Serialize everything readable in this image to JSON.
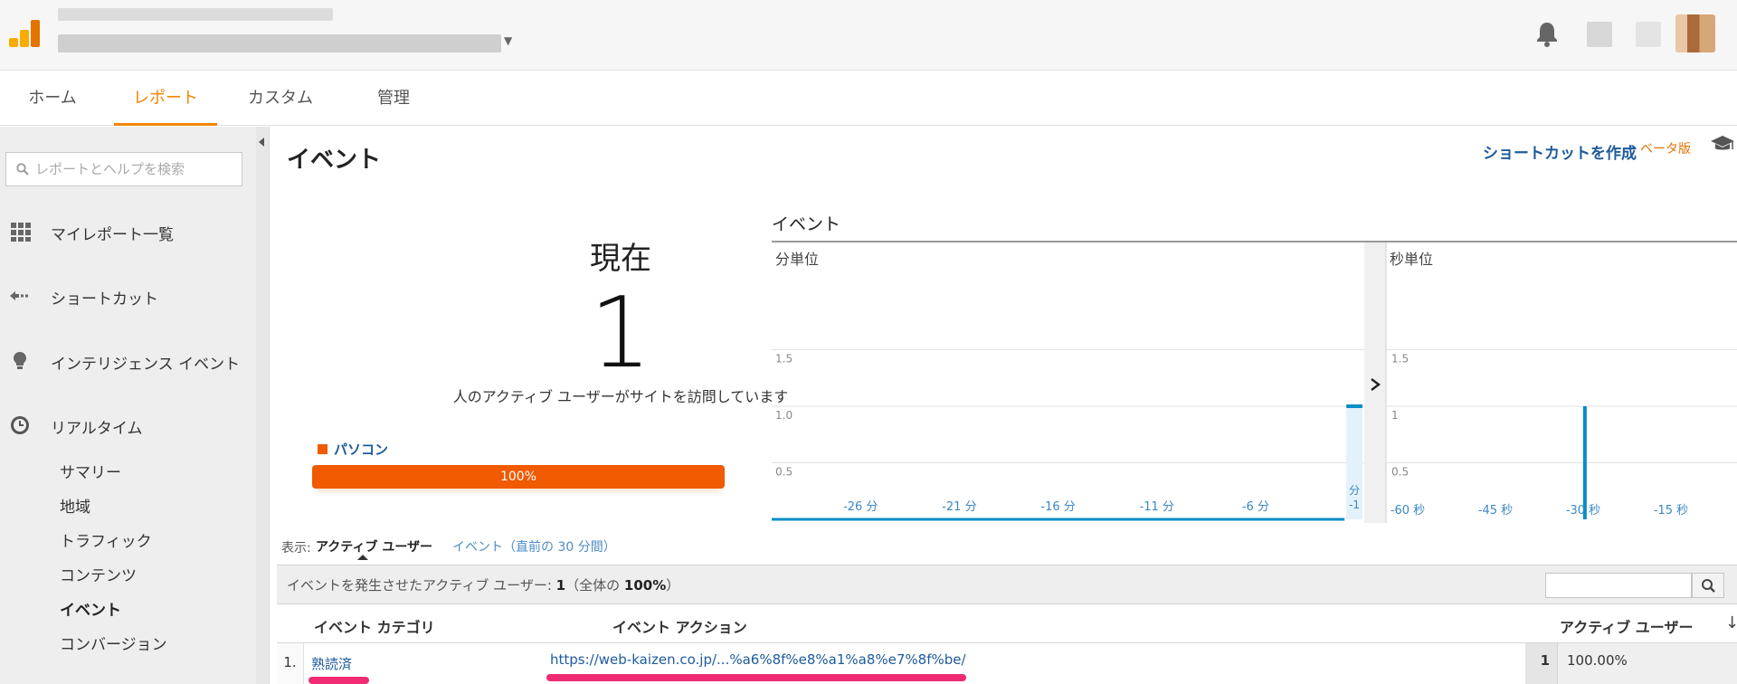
{
  "nav": {
    "tabs": [
      {
        "label": "ホーム"
      },
      {
        "label": "レポート"
      },
      {
        "label": "カスタム"
      },
      {
        "label": "管理"
      }
    ]
  },
  "sidebar": {
    "search_placeholder": "レポートとヘルプを検索",
    "items": [
      {
        "label": "マイレポート一覧",
        "icon": "grid-icon"
      },
      {
        "label": "ショートカット",
        "icon": "shortcut-arrow-icon"
      },
      {
        "label": "インテリジェンス イベント",
        "icon": "lightbulb-icon"
      },
      {
        "label": "リアルタイム",
        "icon": "clock-icon"
      }
    ],
    "sub_items": [
      {
        "label": "サマリー"
      },
      {
        "label": "地域"
      },
      {
        "label": "トラフィック"
      },
      {
        "label": "コンテンツ"
      },
      {
        "label": "イベント",
        "active": true
      },
      {
        "label": "コンバージョン"
      }
    ]
  },
  "main": {
    "title": "イベント",
    "shortcut_label": "ショートカットを作成",
    "beta_label": "ベータ版",
    "now": {
      "label": "現在",
      "count": "1",
      "description": "人のアクティブ ユーザーがサイトを訪問しています",
      "device_label": "パソコン",
      "device_percent": "100%",
      "device_color": "#f05a00"
    },
    "view": {
      "label": "表示:",
      "active": "アクティブ ユーザー",
      "alternate": "イベント（直前の 30 分間）"
    },
    "summary": {
      "prefix": "イベントを発生させたアクティブ ユーザー:",
      "count": "1",
      "total_prefix": "（全体の",
      "total_pct": "100%",
      "total_suffix": "）"
    },
    "table": {
      "headers": [
        "イベント カテゴリ",
        "イベント アクション",
        "アクティブ ユーザー"
      ],
      "rows": [
        {
          "num": "1.",
          "category": "熟読済",
          "action": "https://web-kaizen.co.jp/...%a6%8f%e8%a1%a8%e7%8f%be/",
          "users": "1",
          "pct": "100.00%"
        }
      ]
    }
  },
  "chart_data": [
    {
      "type": "bar",
      "title": "イベント",
      "subtitle": "分単位",
      "x_tick_labels": [
        "-26 分",
        "-21 分",
        "-16 分",
        "-11 分",
        "-6 分",
        "分 -1"
      ],
      "y_tick_labels": [
        "1.5",
        "1.0",
        "0.5"
      ],
      "ylim": [
        0,
        2.0
      ],
      "values": [
        {
          "x": -30,
          "y": 0
        },
        {
          "x": -29,
          "y": 0
        },
        {
          "x": -28,
          "y": 0
        },
        {
          "x": -27,
          "y": 0
        },
        {
          "x": -26,
          "y": 0
        },
        {
          "x": -25,
          "y": 0
        },
        {
          "x": -24,
          "y": 0
        },
        {
          "x": -23,
          "y": 0
        },
        {
          "x": -22,
          "y": 0
        },
        {
          "x": -21,
          "y": 0
        },
        {
          "x": -20,
          "y": 0
        },
        {
          "x": -19,
          "y": 0
        },
        {
          "x": -18,
          "y": 0
        },
        {
          "x": -17,
          "y": 0
        },
        {
          "x": -16,
          "y": 0
        },
        {
          "x": -15,
          "y": 0
        },
        {
          "x": -14,
          "y": 0
        },
        {
          "x": -13,
          "y": 0
        },
        {
          "x": -12,
          "y": 0
        },
        {
          "x": -11,
          "y": 0
        },
        {
          "x": -10,
          "y": 0
        },
        {
          "x": -9,
          "y": 0
        },
        {
          "x": -8,
          "y": 0
        },
        {
          "x": -7,
          "y": 0
        },
        {
          "x": -6,
          "y": 0
        },
        {
          "x": -5,
          "y": 0
        },
        {
          "x": -4,
          "y": 0
        },
        {
          "x": -3,
          "y": 0
        },
        {
          "x": -2,
          "y": 0
        },
        {
          "x": -1,
          "y": 1
        }
      ],
      "grid": true,
      "color": "#058dc7"
    },
    {
      "type": "bar",
      "subtitle": "秒単位",
      "x_tick_labels": [
        "-60 秒",
        "-45 秒",
        "-30 秒",
        "-15 秒"
      ],
      "y_tick_labels": [
        "1.5",
        "1",
        "0.5"
      ],
      "ylim": [
        0,
        2.0
      ],
      "values": [
        {
          "x": -26,
          "y": 1
        }
      ],
      "grid": true,
      "color": "#058dc7"
    }
  ]
}
